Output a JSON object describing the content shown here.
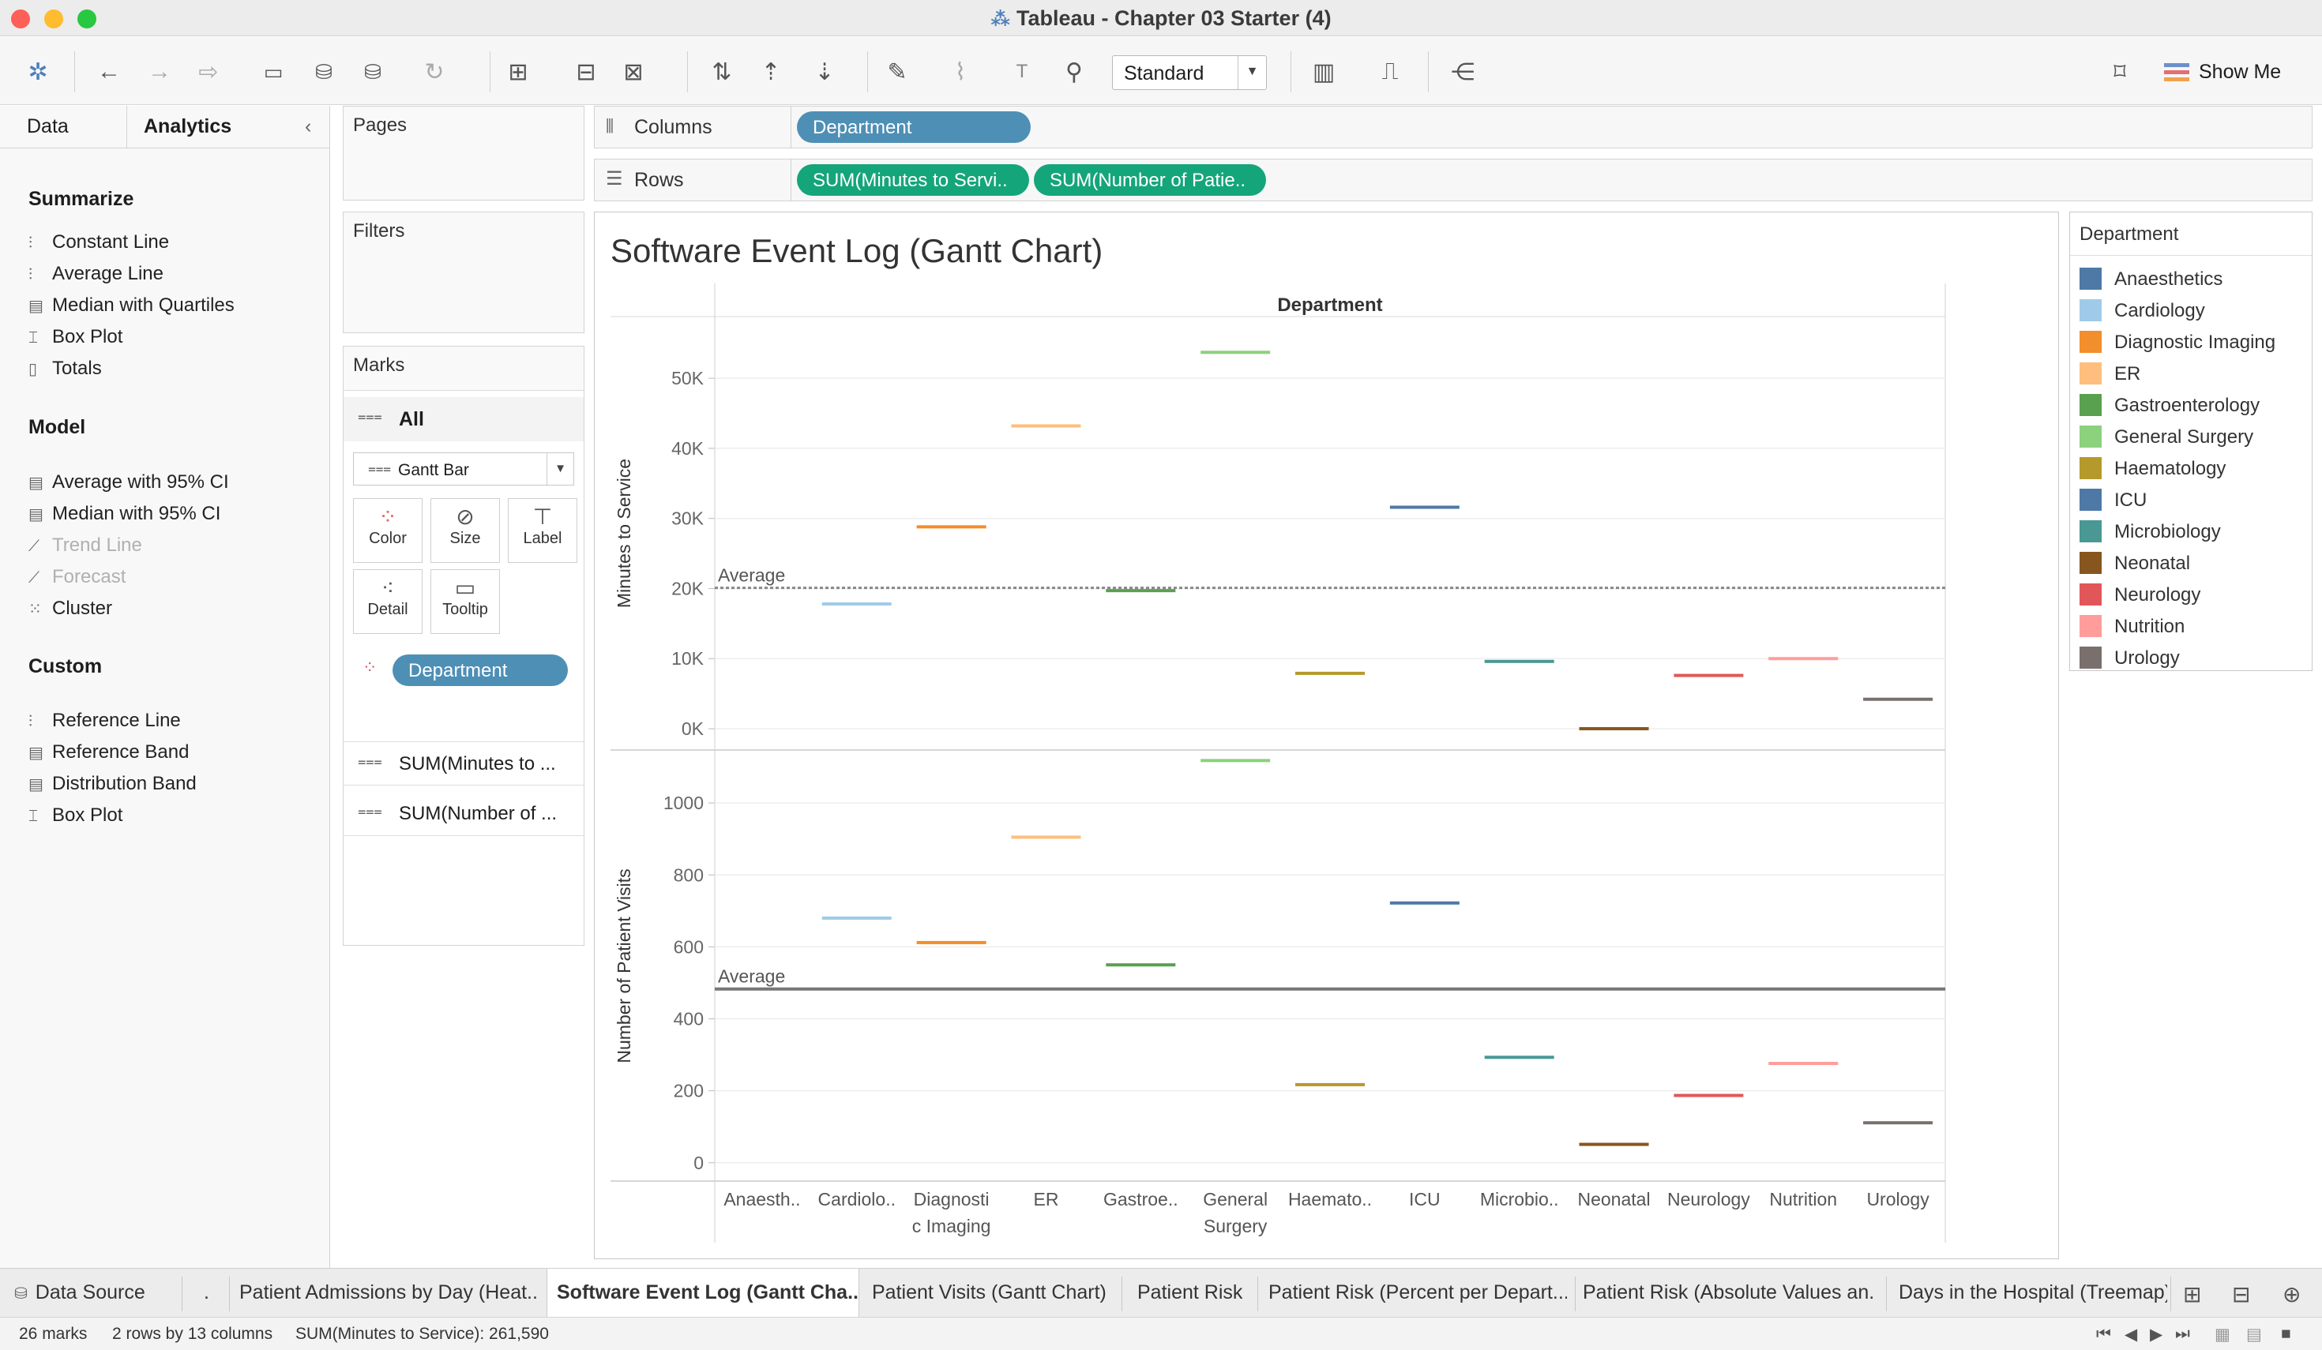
{
  "window": {
    "title": "Tableau - Chapter 03 Starter (4)"
  },
  "toolbar": {
    "view_size": "Standard",
    "show_me": "Show Me"
  },
  "left_panel": {
    "tabs": [
      "Data",
      "Analytics"
    ],
    "sections": [
      {
        "title": "Summarize",
        "items": [
          {
            "label": "Constant Line",
            "icon": "constant-line-icon",
            "enabled": true
          },
          {
            "label": "Average Line",
            "icon": "average-line-icon",
            "enabled": true
          },
          {
            "label": "Median with Quartiles",
            "icon": "median-quartiles-icon",
            "enabled": true
          },
          {
            "label": "Box Plot",
            "icon": "box-plot-icon",
            "enabled": true
          },
          {
            "label": "Totals",
            "icon": "totals-icon",
            "enabled": true
          }
        ]
      },
      {
        "title": "Model",
        "items": [
          {
            "label": "Average with 95% CI",
            "icon": "average-ci-icon",
            "enabled": true
          },
          {
            "label": "Median with 95% CI",
            "icon": "median-ci-icon",
            "enabled": true
          },
          {
            "label": "Trend Line",
            "icon": "trend-line-icon",
            "enabled": false
          },
          {
            "label": "Forecast",
            "icon": "forecast-icon",
            "enabled": false
          },
          {
            "label": "Cluster",
            "icon": "cluster-icon",
            "enabled": true
          }
        ]
      },
      {
        "title": "Custom",
        "items": [
          {
            "label": "Reference Line",
            "icon": "reference-line-icon",
            "enabled": true
          },
          {
            "label": "Reference Band",
            "icon": "reference-band-icon",
            "enabled": true
          },
          {
            "label": "Distribution Band",
            "icon": "distribution-band-icon",
            "enabled": true
          },
          {
            "label": "Box Plot",
            "icon": "box-plot-icon",
            "enabled": true
          }
        ]
      }
    ]
  },
  "cards": {
    "pages": "Pages",
    "filters": "Filters",
    "marks": {
      "title": "Marks",
      "all": "All",
      "mark_type": "Gantt Bar",
      "buttons": [
        "Color",
        "Size",
        "Label",
        "Detail",
        "Tooltip"
      ],
      "color_pill": "Department",
      "measures": [
        "SUM(Minutes to ...",
        "SUM(Number of ..."
      ]
    }
  },
  "shelves": {
    "columns_label": "Columns",
    "columns_pill": "Department",
    "rows_label": "Rows",
    "rows_pills": [
      "SUM(Minutes to Servi..",
      "SUM(Number of Patie.."
    ]
  },
  "legend": {
    "title": "Department",
    "items": [
      {
        "name": "Anaesthetics",
        "color": "#4e79a7"
      },
      {
        "name": "Cardiology",
        "color": "#a0cbe8"
      },
      {
        "name": "Diagnostic Imaging",
        "color": "#f28e2b"
      },
      {
        "name": "ER",
        "color": "#ffbe7d"
      },
      {
        "name": "Gastroenterology",
        "color": "#59a14f"
      },
      {
        "name": "General Surgery",
        "color": "#8cd17d"
      },
      {
        "name": "Haematology",
        "color": "#b6992d"
      },
      {
        "name": "ICU",
        "color": "#4e79a7"
      },
      {
        "name": "Microbiology",
        "color": "#499894"
      },
      {
        "name": "Neonatal",
        "color": "#86561e"
      },
      {
        "name": "Neurology",
        "color": "#e15759"
      },
      {
        "name": "Nutrition",
        "color": "#ff9d9a"
      },
      {
        "name": "Urology",
        "color": "#79706e"
      }
    ]
  },
  "chart_data": {
    "type": "gantt",
    "title": "Software Event Log (Gantt Chart)",
    "column_header": "Department",
    "categories": [
      "Anaesth..",
      "Cardiolo..",
      "Diagnostic Imaging",
      "ER",
      "Gastroe..",
      "General Surgery",
      "Haemato..",
      "ICU",
      "Microbio..",
      "Neonatal",
      "Neurology",
      "Nutrition",
      "Urology"
    ],
    "panes": [
      {
        "ylabel": "Minutes to Service",
        "ylim": [
          -1800,
          57000
        ],
        "ticks": [
          0,
          10000,
          20000,
          30000,
          40000,
          50000
        ],
        "tick_labels": [
          "0K",
          "10K",
          "20K",
          "30K",
          "40K",
          "50K"
        ],
        "values": [
          null,
          17800,
          28800,
          43200,
          19700,
          53700,
          7900,
          31600,
          9600,
          0,
          7600,
          10000,
          4200
        ],
        "average": 20100,
        "average_label": "Average"
      },
      {
        "ylabel": "Number of Patient Visits",
        "ylim": [
          -40,
          1110
        ],
        "ticks": [
          0,
          200,
          400,
          600,
          800,
          1000
        ],
        "tick_labels": [
          "0",
          "200",
          "400",
          "600",
          "800",
          "1000"
        ],
        "values": [
          null,
          680,
          612,
          905,
          550,
          1118,
          217,
          722,
          293,
          51,
          187,
          276,
          111
        ],
        "average": 483,
        "average_label": "Average"
      }
    ]
  },
  "bottom_tabs": {
    "data_source": "Data Source",
    "overflow": ".",
    "sheets": [
      "Patient Admissions by Day (Heat...",
      "Software Event Log (Gantt Cha...",
      "Patient Visits (Gantt Chart)",
      "Patient Risk",
      "Patient Risk (Percent per Depart...",
      "Patient Risk (Absolute Values an...",
      "Days in the Hospital (Treemap)"
    ]
  },
  "status": {
    "marks": "26 marks",
    "dims": "2 rows by 13 columns",
    "sum": "SUM(Minutes to Service): 261,590"
  }
}
